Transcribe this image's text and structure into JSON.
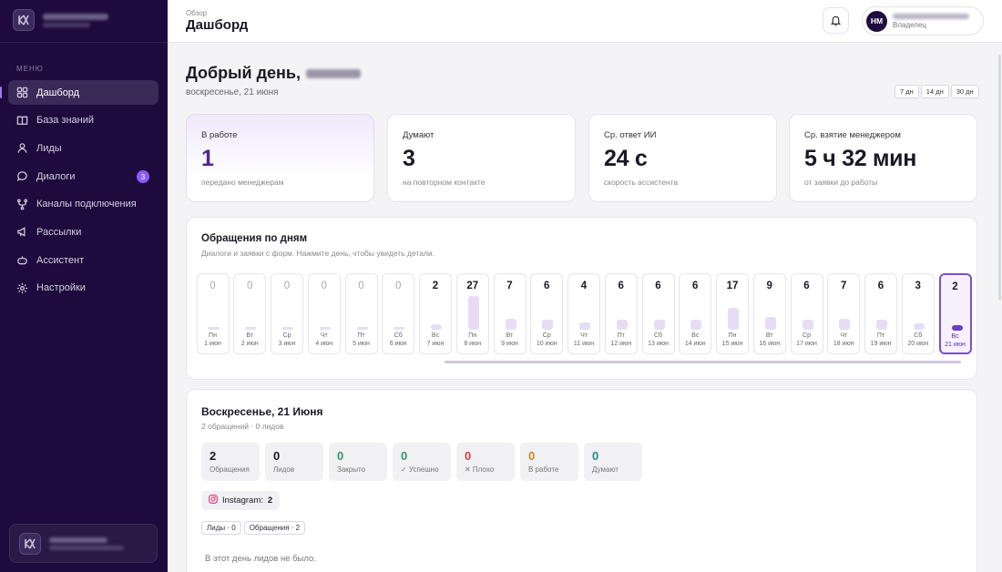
{
  "app": {
    "menu_caption": "МЕНЮ"
  },
  "sidebar": {
    "items": [
      {
        "label": "Дашборд",
        "icon": "grid-icon",
        "active": true
      },
      {
        "label": "База знаний",
        "icon": "book-icon"
      },
      {
        "label": "Лиды",
        "icon": "user-icon"
      },
      {
        "label": "Диалоги",
        "icon": "chat-icon",
        "badge": "3"
      },
      {
        "label": "Каналы подключения",
        "icon": "channels-icon"
      },
      {
        "label": "Рассылки",
        "icon": "megaphone-icon"
      },
      {
        "label": "Ассистент",
        "icon": "assistant-icon"
      },
      {
        "label": "Настройки",
        "icon": "gear-icon"
      }
    ]
  },
  "header": {
    "breadcrumb": "Обзор",
    "title": "Дашборд",
    "user": {
      "initials": "НМ",
      "role": "Владелец"
    }
  },
  "greeting": {
    "text": "Добрый день,",
    "date": "воскресенье, 21 июня"
  },
  "range_options": [
    "7 дн",
    "14 дн",
    "30 дн"
  ],
  "stats": [
    {
      "label": "В работе",
      "value": "1",
      "sub": "передано менеджерам",
      "highlight": true
    },
    {
      "label": "Думают",
      "value": "3",
      "sub": "на повторном контакте"
    },
    {
      "label": "Ср. ответ ИИ",
      "value": "24 с",
      "sub": "скорость ассистента"
    },
    {
      "label": "Ср. взятие менеджером",
      "value": "5 ч 32 мин",
      "sub": "от заявки до работы"
    }
  ],
  "daily": {
    "title": "Обращения по дням",
    "subtitle": "Диалоги и заявки с форм. Нажмите день, чтобы увидеть детали.",
    "days": [
      {
        "count": "0",
        "wd": "Пн",
        "date": "1 июн"
      },
      {
        "count": "0",
        "wd": "Вт",
        "date": "2 июн"
      },
      {
        "count": "0",
        "wd": "Ср",
        "date": "3 июн"
      },
      {
        "count": "0",
        "wd": "Чт",
        "date": "4 июн"
      },
      {
        "count": "0",
        "wd": "Пт",
        "date": "5 июн"
      },
      {
        "count": "0",
        "wd": "Сб",
        "date": "6 июн"
      },
      {
        "count": "2",
        "wd": "Вс",
        "date": "7 июн"
      },
      {
        "count": "27",
        "wd": "Пн",
        "date": "8 июн"
      },
      {
        "count": "7",
        "wd": "Вт",
        "date": "9 июн"
      },
      {
        "count": "6",
        "wd": "Ср",
        "date": "10 июн"
      },
      {
        "count": "4",
        "wd": "Чт",
        "date": "11 июн"
      },
      {
        "count": "6",
        "wd": "Пт",
        "date": "12 июн"
      },
      {
        "count": "6",
        "wd": "Сб",
        "date": "13 июн"
      },
      {
        "count": "6",
        "wd": "Вс",
        "date": "14 июн"
      },
      {
        "count": "17",
        "wd": "Пн",
        "date": "15 июн"
      },
      {
        "count": "9",
        "wd": "Вт",
        "date": "16 июн"
      },
      {
        "count": "6",
        "wd": "Ср",
        "date": "17 июн"
      },
      {
        "count": "7",
        "wd": "Чт",
        "date": "18 июн"
      },
      {
        "count": "6",
        "wd": "Пт",
        "date": "19 июн"
      },
      {
        "count": "3",
        "wd": "Сб",
        "date": "20 июн"
      },
      {
        "count": "2",
        "wd": "Вс",
        "date": "21 июн",
        "selected": true
      }
    ]
  },
  "detail": {
    "title": "Воскресенье, 21 Июня",
    "subtitle": "2 обращений · 0 лидов",
    "tiles": [
      {
        "value": "2",
        "label": "Обращения",
        "color": "#1a1a22"
      },
      {
        "value": "0",
        "label": "Лидов",
        "color": "#1a1a22"
      },
      {
        "value": "0",
        "label": "Закрыто",
        "color": "#2e9a5b"
      },
      {
        "value": "0",
        "label": "✓ Успешно",
        "color": "#2e9a5b"
      },
      {
        "value": "0",
        "label": "✕ Плохо",
        "color": "#d14343"
      },
      {
        "value": "0",
        "label": "В работе",
        "color": "#c9891d"
      },
      {
        "value": "0",
        "label": "Думают",
        "color": "#1f8f7a"
      }
    ],
    "source": {
      "name": "Instagram:",
      "count": "2"
    },
    "filters": [
      "Лиды · 0",
      "Обращения · 2"
    ],
    "empty_note": "В этот день лидов не было."
  }
}
